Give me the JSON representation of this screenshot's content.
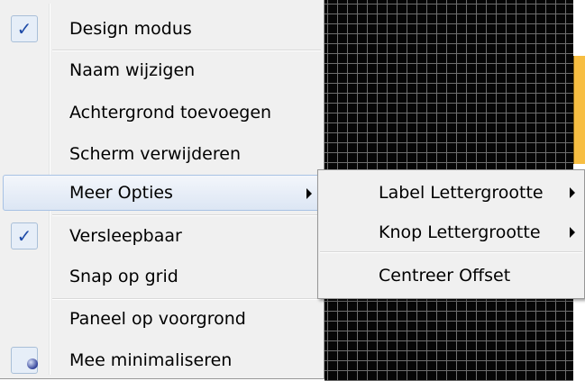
{
  "menu": {
    "items": [
      {
        "label": "Design modus",
        "checked": true
      },
      {
        "label": "Naam wijzigen"
      },
      {
        "label": "Achtergrond toevoegen"
      },
      {
        "label": "Scherm verwijderen"
      },
      {
        "label": "Meer Opties",
        "submenu": true,
        "highlighted": true
      },
      {
        "label": "Versleepbaar",
        "checked": true
      },
      {
        "label": "Snap op grid"
      },
      {
        "label": "Paneel op voorgrond"
      },
      {
        "label": "Mee minimaliseren",
        "radio": true
      }
    ]
  },
  "submenu": {
    "items": [
      {
        "label": "Label Lettergrootte",
        "submenu": true
      },
      {
        "label": "Knop Lettergrootte",
        "submenu": true
      },
      {
        "label": "Centreer Offset"
      }
    ]
  },
  "icons": {
    "check": "✓",
    "check_icon_name": "checkmark-icon",
    "radio_icon_name": "radio-dot-icon",
    "arrow_icon_name": "submenu-arrow-icon"
  },
  "colors": {
    "menu_bg": "#f0f0f0",
    "highlight_border": "#a8c2e4",
    "check_color": "#1e4ba8",
    "grid_bg": "#060606",
    "grid_line": "#6e6e6e",
    "accent_orange": "#f7be42"
  }
}
